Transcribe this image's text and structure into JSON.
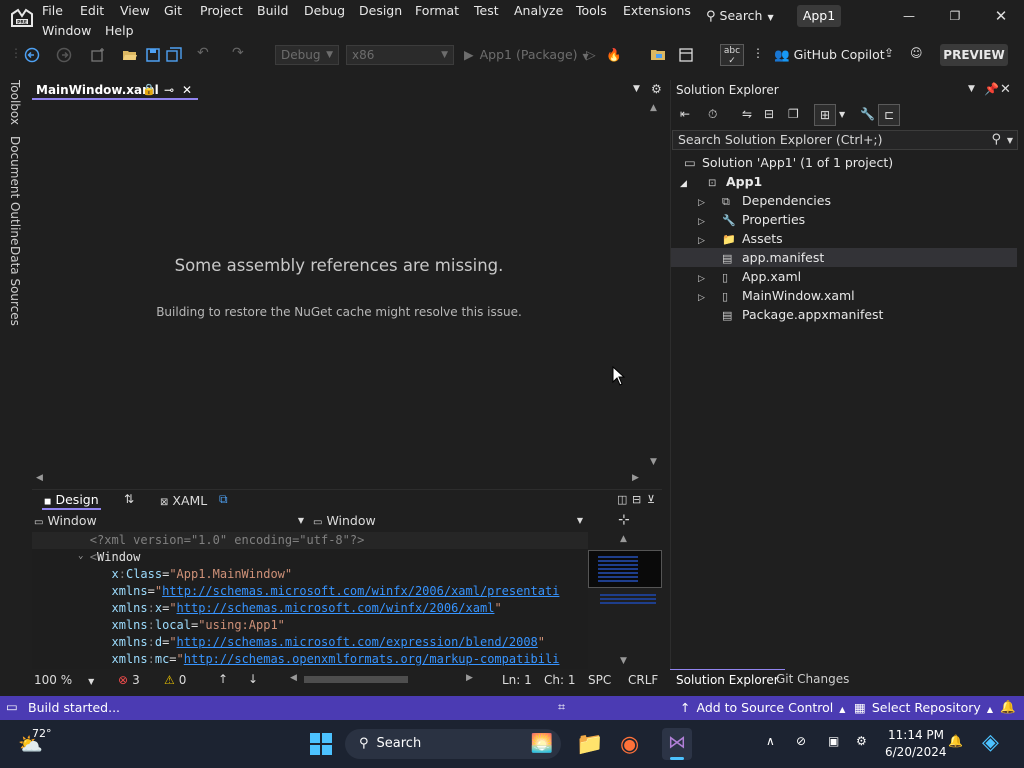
{
  "menubar": {
    "items": [
      "File",
      "Edit",
      "View",
      "Git",
      "Project",
      "Build",
      "Debug",
      "Design",
      "Format",
      "Test",
      "Analyze",
      "Tools",
      "Extensions",
      "Window",
      "Help"
    ],
    "search_label": "Search",
    "solution_badge": "App1"
  },
  "toolbar": {
    "config_value": "Debug",
    "platform_value": "x86",
    "run_target": "App1 (Package)",
    "copilot_label": "GitHub Copilot",
    "preview_label": "PREVIEW"
  },
  "side_tabs": [
    "Toolbox",
    "Document Outline",
    "Data Sources"
  ],
  "document": {
    "tab_title": "MainWindow.xaml",
    "message_title": "Some assembly references are missing.",
    "message_detail": "Building to restore the NuGet cache might resolve this issue.",
    "design_tab": "Design",
    "xaml_tab": "XAML",
    "nav_left": "Window",
    "nav_right": "Window"
  },
  "code_lines": [
    {
      "parts": [
        [
          "punct",
          "<?xml version=\"1.0\" encoding=\"utf-8\"?>"
        ]
      ],
      "indent": "        "
    },
    {
      "parts": [
        [
          "punct",
          "<"
        ],
        [
          "white",
          "Window"
        ]
      ],
      "indent": "        "
    },
    {
      "parts": [
        [
          "attr",
          "x"
        ],
        [
          "punct",
          ":"
        ],
        [
          "attr",
          "Class"
        ],
        [
          "white",
          "="
        ],
        [
          "str",
          "\"App1.MainWindow\""
        ]
      ],
      "indent": "           "
    },
    {
      "parts": [
        [
          "attr",
          "xmlns"
        ],
        [
          "white",
          "="
        ],
        [
          "str",
          "\""
        ],
        [
          "url",
          "http://schemas.microsoft.com/winfx/2006/xaml/presentati"
        ]
      ],
      "indent": "           "
    },
    {
      "parts": [
        [
          "attr",
          "xmlns"
        ],
        [
          "punct",
          ":"
        ],
        [
          "attr",
          "x"
        ],
        [
          "white",
          "="
        ],
        [
          "str",
          "\""
        ],
        [
          "url",
          "http://schemas.microsoft.com/winfx/2006/xaml"
        ],
        [
          "str",
          "\""
        ]
      ],
      "indent": "           "
    },
    {
      "parts": [
        [
          "attr",
          "xmlns"
        ],
        [
          "punct",
          ":"
        ],
        [
          "attr",
          "local"
        ],
        [
          "white",
          "="
        ],
        [
          "str",
          "\"using:App1\""
        ]
      ],
      "indent": "           "
    },
    {
      "parts": [
        [
          "attr",
          "xmlns"
        ],
        [
          "punct",
          ":"
        ],
        [
          "attr",
          "d"
        ],
        [
          "white",
          "="
        ],
        [
          "str",
          "\""
        ],
        [
          "url",
          "http://schemas.microsoft.com/expression/blend/2008"
        ],
        [
          "str",
          "\""
        ]
      ],
      "indent": "           "
    },
    {
      "parts": [
        [
          "attr",
          "xmlns"
        ],
        [
          "punct",
          ":"
        ],
        [
          "attr",
          "mc"
        ],
        [
          "white",
          "="
        ],
        [
          "str",
          "\""
        ],
        [
          "url",
          "http://schemas.openxmlformats.org/markup-compatibili"
        ]
      ],
      "indent": "           "
    }
  ],
  "editor_status": {
    "zoom": "100 %",
    "errors": "3",
    "warnings": "0",
    "line": "Ln: 1",
    "col": "Ch: 1",
    "spacing": "SPC",
    "eol": "CRLF"
  },
  "solution_explorer": {
    "title": "Solution Explorer",
    "search_placeholder": "Search Solution Explorer (Ctrl+;)",
    "solution": "Solution 'App1' (1 of 1 project)",
    "project": "App1",
    "items": [
      "Dependencies",
      "Properties",
      "Assets",
      "app.manifest",
      "App.xaml",
      "MainWindow.xaml",
      "Package.appxmanifest"
    ],
    "tabs": [
      "Solution Explorer",
      "Git Changes"
    ]
  },
  "statusbar": {
    "message": "Build started...",
    "source_control": "Add to Source Control",
    "repository": "Select Repository"
  },
  "taskbar": {
    "temperature": "72°",
    "search_label": "Search",
    "time": "11:14 PM",
    "date": "6/20/2024"
  },
  "colors": {
    "accent": "#4b3bb3",
    "tab_underline": "#9184ee",
    "background": "#1f1f1f"
  }
}
